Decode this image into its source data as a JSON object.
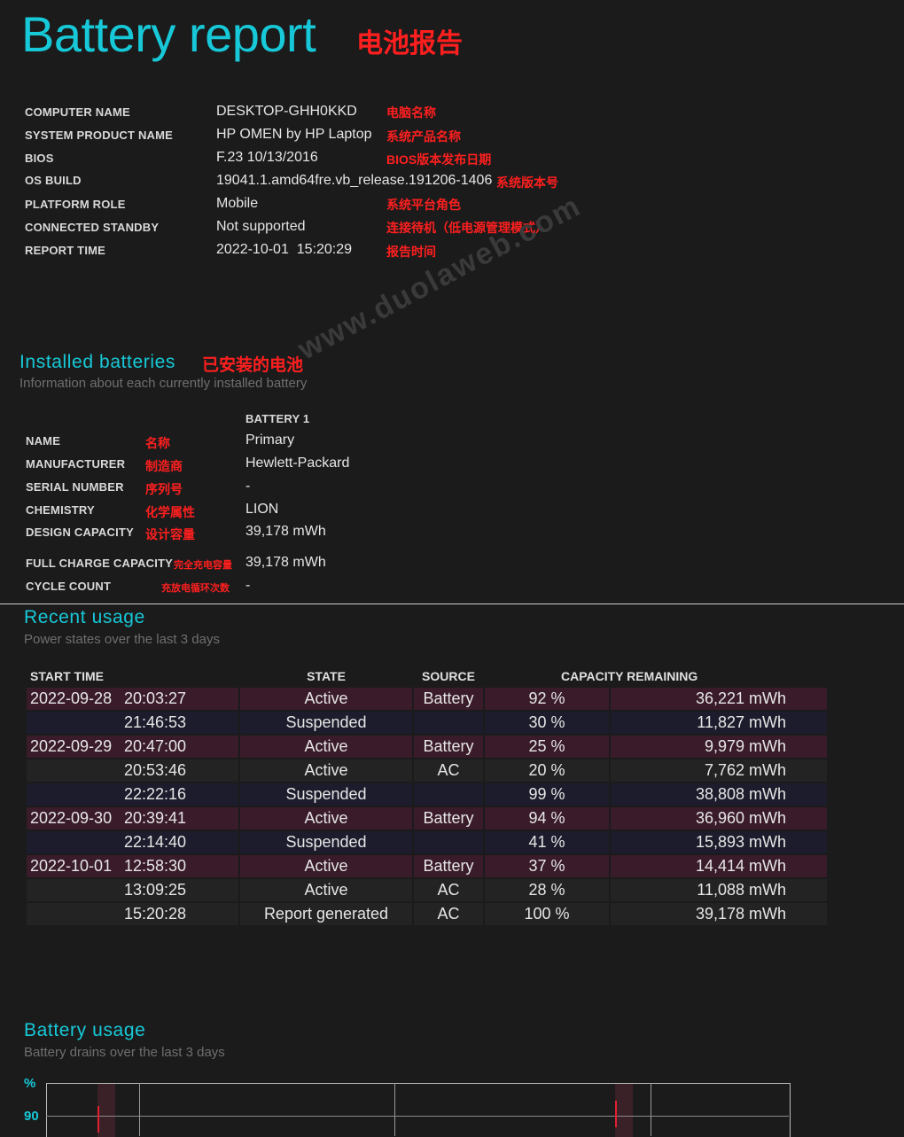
{
  "header": {
    "title": "Battery report",
    "title_cn": "电池报告"
  },
  "system_info": [
    {
      "label": "COMPUTER NAME",
      "value": "DESKTOP-GHH0KKD",
      "note": "电脑名称"
    },
    {
      "label": "SYSTEM PRODUCT NAME",
      "value": "HP OMEN by HP Laptop",
      "note": "系统产品名称"
    },
    {
      "label": "BIOS",
      "value": "F.23 10/13/2016",
      "note": "BIOS版本发布日期"
    },
    {
      "label": "OS BUILD",
      "value": "19041.1.amd64fre.vb_release.191206-1406",
      "note": "系统版本号"
    },
    {
      "label": "PLATFORM ROLE",
      "value": "Mobile",
      "note": "系统平台角色"
    },
    {
      "label": "CONNECTED STANDBY",
      "value": "Not supported",
      "note": "连接待机（低电源管理模式）"
    },
    {
      "label": "REPORT TIME",
      "value": "2022-10-01  15:20:29",
      "note": "报告时间"
    }
  ],
  "watermark": "www.duolaweb.com",
  "installed": {
    "title": "Installed batteries",
    "title_cn": "已安装的电池",
    "subtitle": "Information about each currently installed battery",
    "column": "BATTERY 1",
    "rows": [
      {
        "label": "NAME",
        "note": "名称",
        "value": "Primary"
      },
      {
        "label": "MANUFACTURER",
        "note": "制造商",
        "value": "Hewlett-Packard"
      },
      {
        "label": "SERIAL NUMBER",
        "note": "序列号",
        "value": "-"
      },
      {
        "label": "CHEMISTRY",
        "note": "化学属性",
        "value": "LION"
      },
      {
        "label": "DESIGN CAPACITY",
        "note": "设计容量",
        "value": "39,178 mWh"
      },
      {
        "label": "FULL CHARGE CAPACITY",
        "note": "完全充电容量",
        "value": "39,178 mWh"
      },
      {
        "label": "CYCLE COUNT",
        "note": "充放电循环次数",
        "value": "-"
      }
    ]
  },
  "recent_usage": {
    "title": "Recent usage",
    "subtitle": "Power states over the last 3 days",
    "columns": [
      "START TIME",
      "STATE",
      "SOURCE",
      "CAPACITY REMAINING"
    ],
    "rows": [
      {
        "date": "2022-09-28",
        "time": "20:03:27",
        "state": "Active",
        "source": "Battery",
        "pct": "92 %",
        "cap": "36,221 mWh"
      },
      {
        "date": "",
        "time": "21:46:53",
        "state": "Suspended",
        "source": "",
        "pct": "30 %",
        "cap": "11,827 mWh"
      },
      {
        "date": "2022-09-29",
        "time": "20:47:00",
        "state": "Active",
        "source": "Battery",
        "pct": "25 %",
        "cap": "9,979 mWh"
      },
      {
        "date": "",
        "time": "20:53:46",
        "state": "Active",
        "source": "AC",
        "pct": "20 %",
        "cap": "7,762 mWh"
      },
      {
        "date": "",
        "time": "22:22:16",
        "state": "Suspended",
        "source": "",
        "pct": "99 %",
        "cap": "38,808 mWh"
      },
      {
        "date": "2022-09-30",
        "time": "20:39:41",
        "state": "Active",
        "source": "Battery",
        "pct": "94 %",
        "cap": "36,960 mWh"
      },
      {
        "date": "",
        "time": "22:14:40",
        "state": "Suspended",
        "source": "",
        "pct": "41 %",
        "cap": "15,893 mWh"
      },
      {
        "date": "2022-10-01",
        "time": "12:58:30",
        "state": "Active",
        "source": "Battery",
        "pct": "37 %",
        "cap": "14,414 mWh"
      },
      {
        "date": "",
        "time": "13:09:25",
        "state": "Active",
        "source": "AC",
        "pct": "28 %",
        "cap": "11,088 mWh"
      },
      {
        "date": "",
        "time": "15:20:28",
        "state": "Report generated",
        "source": "AC",
        "pct": "100 %",
        "cap": "39,178 mWh"
      }
    ]
  },
  "battery_usage": {
    "title": "Battery usage",
    "subtitle": "Battery drains over the last 3 days",
    "y_unit": "%",
    "y_tick": "90"
  },
  "colors": {
    "accent": "#17c9d8",
    "annotation": "#ff1f1f",
    "row_battery": "#3a1b2a",
    "row_suspended": "#1c1c2c",
    "row_ac": "#232323"
  }
}
